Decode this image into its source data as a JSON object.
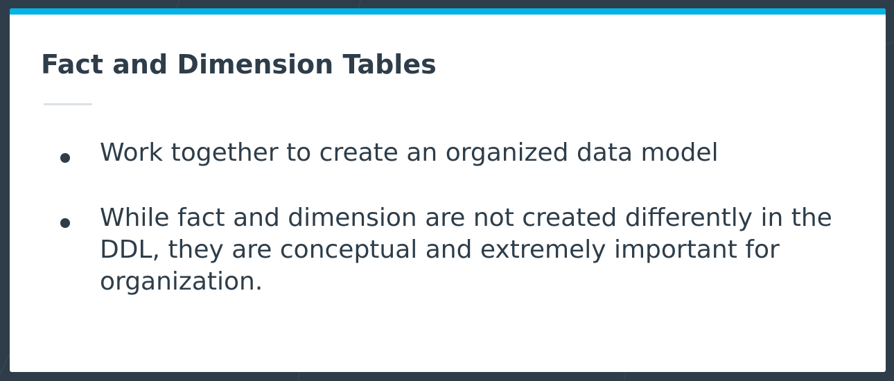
{
  "slide": {
    "title": "Fact and Dimension Tables",
    "bullets": [
      "Work together to create an organized data model",
      "While fact and dimension are not created differently in the\nDDL, they  are conceptual and extremely important for\norganization."
    ]
  },
  "colors": {
    "background": "#2e3d49",
    "accent": "#02b3e4",
    "card": "#ffffff",
    "text": "#2e3d49",
    "rule": "#dbe2e8"
  }
}
